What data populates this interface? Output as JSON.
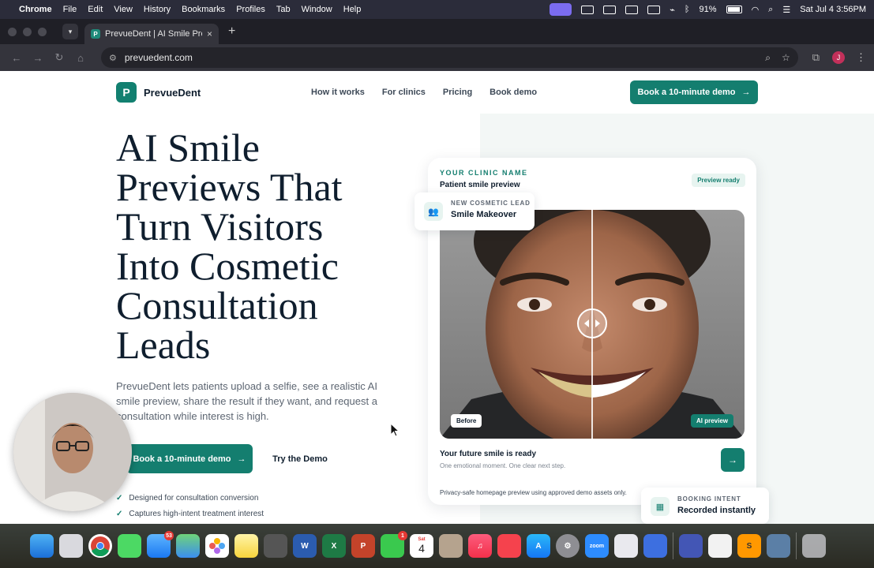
{
  "menubar": {
    "app": "Chrome",
    "menus": [
      "File",
      "Edit",
      "View",
      "History",
      "Bookmarks",
      "Profiles",
      "Tab",
      "Window",
      "Help"
    ],
    "battery": "91%",
    "datetime": "Sat Jul 4  3:56PM"
  },
  "browser": {
    "tab_title": "PrevueDent | AI Smile Preview",
    "favicon_letter": "P",
    "url": "prevuedent.com",
    "profile_initial": "J"
  },
  "site": {
    "brand_name": "PrevueDent",
    "logo_letter": "P",
    "nav": [
      "How it works",
      "For clinics",
      "Pricing",
      "Book demo"
    ],
    "top_cta": "Book a 10-minute demo",
    "hero_lines": [
      "AI Smile",
      "Previews That",
      "Turn Visitors",
      "Into Cosmetic",
      "Consultation",
      "Leads"
    ],
    "hero_sub": "PrevueDent lets patients upload a selfie, see a realistic AI smile preview, share the result if they want, and request a consultation while interest is high.",
    "primary_cta": "Book a 10-minute demo",
    "secondary_cta": "Try the Demo",
    "checks": [
      "Designed for consultation conversion",
      "Captures high-intent treatment interest"
    ]
  },
  "preview_card": {
    "clinic_label": "YOUR CLINIC NAME",
    "subtitle": "Patient smile preview",
    "status": "Preview ready",
    "before_tag": "Before",
    "after_tag": "AI preview",
    "future_title": "Your future smile is ready",
    "future_sub": "One emotional moment. One clear next step.",
    "privacy": "Privacy-safe homepage preview using approved demo assets only."
  },
  "lead_pill": {
    "label": "NEW COSMETIC LEAD",
    "value": "Smile Makeover"
  },
  "booking_pill": {
    "label": "BOOKING INTENT",
    "value": "Recorded instantly"
  },
  "dock": {
    "apps": [
      "finder",
      "launchpad",
      "chrome",
      "messages",
      "mail",
      "maps",
      "photos",
      "notes",
      "calculator",
      "word",
      "excel",
      "powerpoint",
      "facetime",
      "calendar",
      "contacts",
      "music",
      "news",
      "app-store",
      "settings",
      "zoom",
      "preview",
      "notion",
      "shortcuts",
      "textedit",
      "sublime",
      "automator",
      "trash"
    ],
    "mail_badge": "53",
    "facetime_badge": "1",
    "calendar_month": "Sat",
    "calendar_day": "4",
    "zoom_label": "zoom"
  },
  "colors": {
    "brand": "#147e6f",
    "ink": "#0f1e2e"
  }
}
